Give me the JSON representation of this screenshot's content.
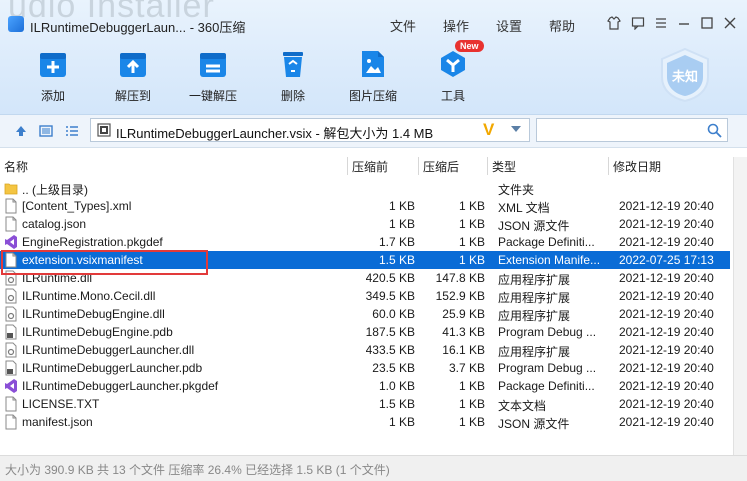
{
  "background_text": "udio Installer",
  "window": {
    "title": "ILRuntimeDebuggerLaun... - 360压缩",
    "menu": [
      "文件",
      "操作",
      "设置",
      "帮助"
    ]
  },
  "toolbar": {
    "items": [
      {
        "label": "添加",
        "icon": "add-icon"
      },
      {
        "label": "解压到",
        "icon": "extract-to-icon"
      },
      {
        "label": "一键解压",
        "icon": "one-click-extract-icon"
      },
      {
        "label": "删除",
        "icon": "delete-icon"
      },
      {
        "label": "图片压缩",
        "icon": "image-compress-icon"
      },
      {
        "label": "工具",
        "icon": "tools-icon"
      }
    ],
    "new_badge": "New",
    "shield_label": "未知"
  },
  "address": {
    "path": "ILRuntimeDebuggerLauncher.vsix - 解包大小为 1.4 MB",
    "logo": "V"
  },
  "search": {
    "placeholder": ""
  },
  "columns": {
    "name": "名称",
    "size": "压缩前",
    "packed": "压缩后",
    "type": "类型",
    "date": "修改日期"
  },
  "files": [
    {
      "name": ".. (上级目录)",
      "size": "",
      "packed": "",
      "type": "文件夹",
      "date": "",
      "icon": "folder-icon"
    },
    {
      "name": "[Content_Types].xml",
      "size": "1 KB",
      "packed": "1 KB",
      "type": "XML 文档",
      "date": "2021-12-19 20:40",
      "icon": "file-icon"
    },
    {
      "name": "catalog.json",
      "size": "1 KB",
      "packed": "1 KB",
      "type": "JSON 源文件",
      "date": "2021-12-19 20:40",
      "icon": "file-icon"
    },
    {
      "name": "EngineRegistration.pkgdef",
      "size": "1.7 KB",
      "packed": "1 KB",
      "type": "Package Definiti...",
      "date": "2021-12-19 20:40",
      "icon": "visual-studio-icon"
    },
    {
      "name": "extension.vsixmanifest",
      "size": "1.5 KB",
      "packed": "1 KB",
      "type": "Extension Manife...",
      "date": "2022-07-25 17:13",
      "icon": "file-icon",
      "selected": true
    },
    {
      "name": "ILRuntime.dll",
      "size": "420.5 KB",
      "packed": "147.8 KB",
      "type": "应用程序扩展",
      "date": "2021-12-19 20:40",
      "icon": "dll-icon"
    },
    {
      "name": "ILRuntime.Mono.Cecil.dll",
      "size": "349.5 KB",
      "packed": "152.9 KB",
      "type": "应用程序扩展",
      "date": "2021-12-19 20:40",
      "icon": "dll-icon"
    },
    {
      "name": "ILRuntimeDebugEngine.dll",
      "size": "60.0 KB",
      "packed": "25.9 KB",
      "type": "应用程序扩展",
      "date": "2021-12-19 20:40",
      "icon": "dll-icon"
    },
    {
      "name": "ILRuntimeDebugEngine.pdb",
      "size": "187.5 KB",
      "packed": "41.3 KB",
      "type": "Program Debug ...",
      "date": "2021-12-19 20:40",
      "icon": "pdb-icon"
    },
    {
      "name": "ILRuntimeDebuggerLauncher.dll",
      "size": "433.5 KB",
      "packed": "16.1 KB",
      "type": "应用程序扩展",
      "date": "2021-12-19 20:40",
      "icon": "dll-icon"
    },
    {
      "name": "ILRuntimeDebuggerLauncher.pdb",
      "size": "23.5 KB",
      "packed": "3.7 KB",
      "type": "Program Debug ...",
      "date": "2021-12-19 20:40",
      "icon": "pdb-icon"
    },
    {
      "name": "ILRuntimeDebuggerLauncher.pkgdef",
      "size": "1.0 KB",
      "packed": "1 KB",
      "type": "Package Definiti...",
      "date": "2021-12-19 20:40",
      "icon": "visual-studio-icon"
    },
    {
      "name": "LICENSE.TXT",
      "size": "1.5 KB",
      "packed": "1 KB",
      "type": "文本文档",
      "date": "2021-12-19 20:40",
      "icon": "file-icon"
    },
    {
      "name": "manifest.json",
      "size": "1 KB",
      "packed": "1 KB",
      "type": "JSON 源文件",
      "date": "2021-12-19 20:40",
      "icon": "file-icon"
    }
  ],
  "status": "大小为 390.9 KB 共 13 个文件 压缩率 26.4% 已经选择 1.5 KB (1 个文件)",
  "colors": {
    "selection": "#0a6cd6",
    "highlight_box": "#e23a3a",
    "toolbar_icon": "#1a86e8"
  }
}
